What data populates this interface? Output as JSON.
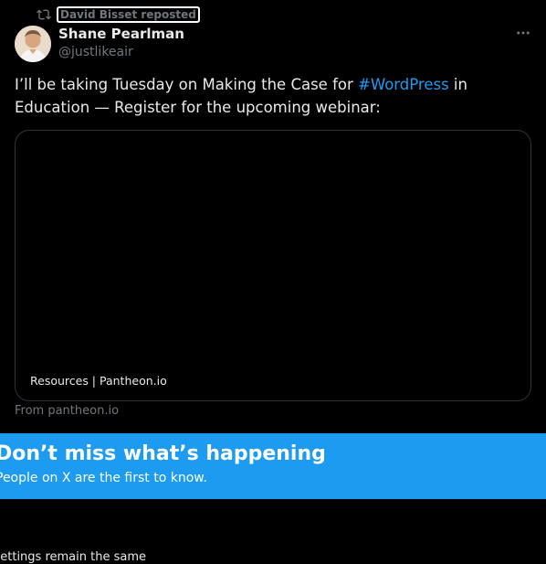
{
  "repost": {
    "label": "David Bisset reposted",
    "icon": "repost-icon"
  },
  "author": {
    "name": "Shane Pearlman",
    "handle": "@justlikeair"
  },
  "post": {
    "text_before": "I’ll be taking Tuesday on Making the Case for ",
    "hashtag": "#WordPress",
    "text_after": " in Education — Register for the upcoming webinar:"
  },
  "card": {
    "caption": "Resources | Pantheon.io",
    "source": "From pantheon.io"
  },
  "banner": {
    "title": "Don’t miss what’s happening",
    "subtitle": "People on X are the first to know."
  },
  "footer": {
    "text": "Settings remain the same"
  },
  "colors": {
    "accent": "#1d9bf0",
    "background": "#000000",
    "muted": "#71767b"
  }
}
